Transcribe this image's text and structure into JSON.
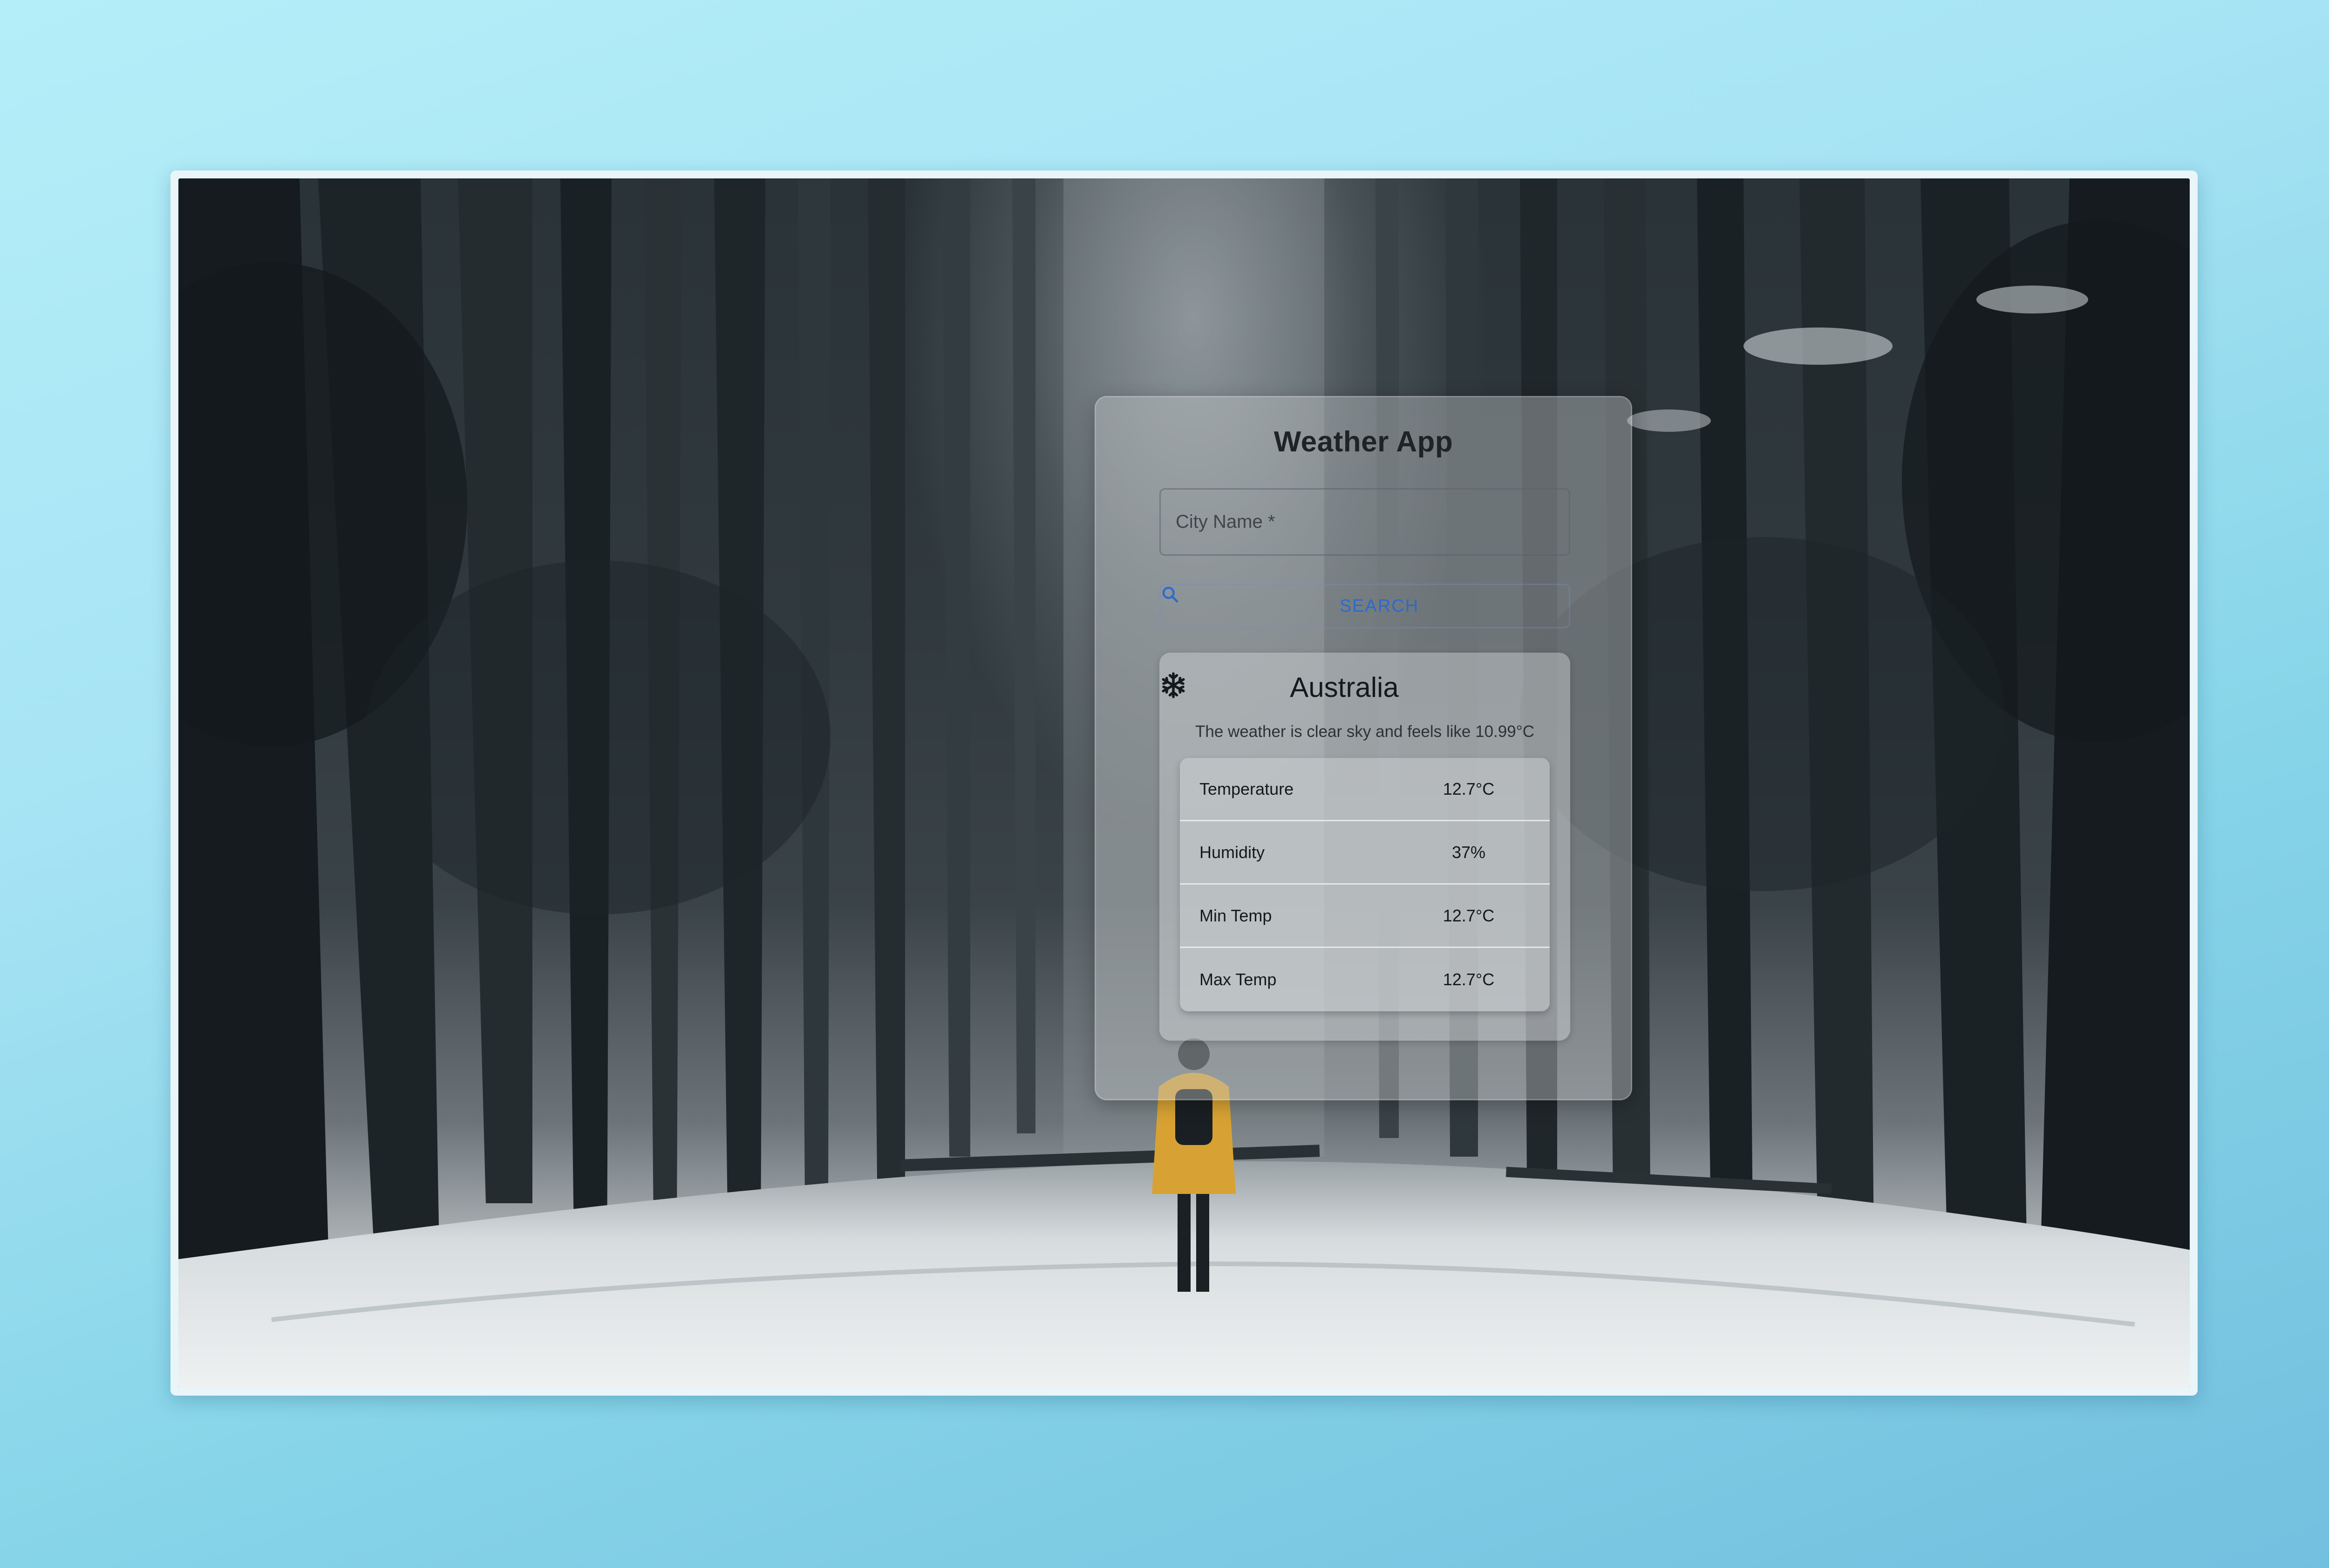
{
  "app": {
    "title": "Weather App"
  },
  "search": {
    "placeholder": "City Name *",
    "value": "",
    "button_label": "SEARCH",
    "icon": "search-icon"
  },
  "result": {
    "country": "Australia",
    "weather_icon": "snowflake-icon",
    "description": "The weather is clear sky and feels like 10.99°C",
    "rows": [
      {
        "label": "Temperature",
        "value": "12.7°C"
      },
      {
        "label": "Humidity",
        "value": "37%"
      },
      {
        "label": "Min Temp",
        "value": "12.7°C"
      },
      {
        "label": "Max Temp",
        "value": "12.7°C"
      }
    ]
  },
  "colors": {
    "page_gradient_start": "#b4eef8",
    "page_gradient_end": "#72bfdf",
    "accent": "#2a6bd0",
    "text_dark": "#1e2326"
  }
}
